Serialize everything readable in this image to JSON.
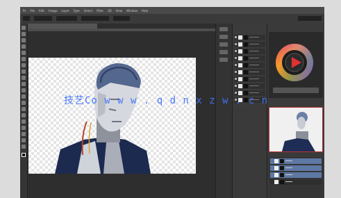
{
  "app": {
    "name": "Adobe Photoshop"
  },
  "menu": {
    "items": [
      "Ps",
      "File",
      "Edit",
      "Image",
      "Layer",
      "Type",
      "Select",
      "Filter",
      "3D",
      "View",
      "Window",
      "Help"
    ]
  },
  "watermark": {
    "text": "技艺Co  w w w . q d n x z w . c n"
  },
  "icons": {
    "tools": [
      "move-icon",
      "marquee-icon",
      "lasso-icon",
      "quick-select-icon",
      "crop-icon",
      "eyedropper-icon",
      "healing-icon",
      "brush-icon",
      "stamp-icon",
      "history-brush-icon",
      "eraser-icon",
      "gradient-icon",
      "blur-icon",
      "dodge-icon",
      "pen-icon",
      "type-icon",
      "path-select-icon",
      "shape-icon",
      "hand-icon",
      "zoom-icon"
    ]
  },
  "colors": {
    "accent": "#5a6f93",
    "navigator_border": "#b33333",
    "watermark": "#3f74ff"
  }
}
